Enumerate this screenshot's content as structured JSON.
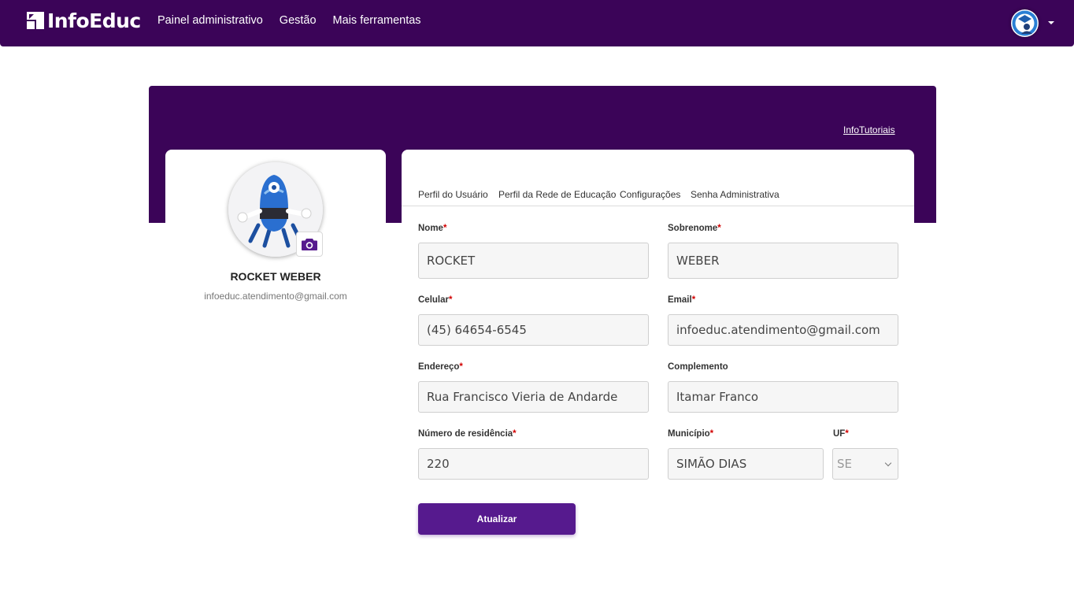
{
  "brand": {
    "name": "InfoEduc"
  },
  "nav": {
    "links": [
      "Painel administrativo",
      "Gestão",
      "Mais ferramentas"
    ]
  },
  "hero": {
    "tutorials_link": "InfoTutoriais"
  },
  "profile": {
    "name": "ROCKET WEBER",
    "email": "infoeduc.atendimento@gmail.com"
  },
  "tabs": [
    "Perfil do Usuário",
    "Perfil da Rede de Educação",
    "Configurações",
    "Senha Administrativa"
  ],
  "form": {
    "required_mark": "*",
    "nome": {
      "label": "Nome",
      "value": "ROCKET"
    },
    "sobrenome": {
      "label": "Sobrenome",
      "value": "WEBER"
    },
    "celular": {
      "label": "Celular",
      "value": "(45) 64654-6545"
    },
    "email": {
      "label": "Email",
      "value": "infoeduc.atendimento@gmail.com"
    },
    "endereco": {
      "label": "Endereço",
      "value": "Rua Francisco Vieria de Andarde"
    },
    "complemento": {
      "label": "Complemento",
      "value": "Itamar Franco"
    },
    "numero": {
      "label": "Número de residência",
      "value": "220"
    },
    "municipio": {
      "label": "Município",
      "value": "SIMÃO DIAS"
    },
    "uf": {
      "label": "UF",
      "value": "SE"
    },
    "submit_label": "Atualizar"
  },
  "colors": {
    "primary": "#3b0458",
    "button": "#561a8e",
    "required": "#d10000"
  },
  "icons": {
    "logo": "infoeduc-logo-icon",
    "camera": "camera-icon",
    "avatar": "user-avatar",
    "caret": "caret-down-icon"
  }
}
